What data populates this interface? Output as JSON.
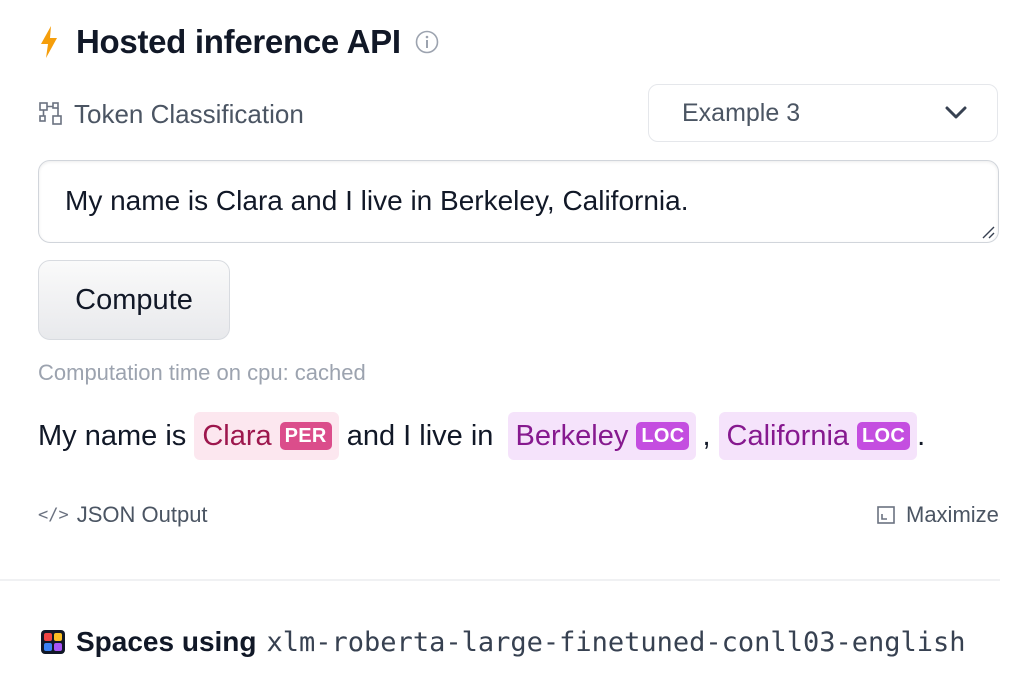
{
  "header": {
    "title": "Hosted inference API"
  },
  "task": {
    "label": "Token Classification"
  },
  "example_select": {
    "selected": "Example 3"
  },
  "input": {
    "value": "My name is Clara and I live in Berkeley, California."
  },
  "compute_button": {
    "label": "Compute"
  },
  "computation_time": "Computation time on cpu: cached",
  "output": {
    "text_1": "My name is ",
    "entity_1": {
      "text": "Clara",
      "tag": "PER"
    },
    "text_2": " and I live in ",
    "entity_2": {
      "text": "Berkeley",
      "tag": "LOC"
    },
    "text_3": ",",
    "entity_3": {
      "text": "California",
      "tag": "LOC"
    },
    "text_4": "."
  },
  "links": {
    "json_output": "JSON Output",
    "maximize": "Maximize"
  },
  "spaces": {
    "label": "Spaces using",
    "model": "xlm-roberta-large-finetuned-conll03-english"
  },
  "colors": {
    "accent_bolt": "#f59e0b",
    "per_tag": "#db4d8b",
    "loc_tag": "#c44ee0"
  },
  "icons": [
    "lightning-icon",
    "info-icon",
    "token-classification-icon",
    "chevron-down-icon",
    "code-icon",
    "maximize-icon",
    "spaces-icon"
  ]
}
